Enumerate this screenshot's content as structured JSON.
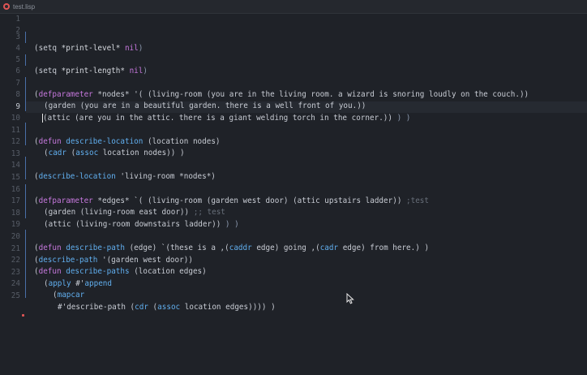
{
  "tab": {
    "title": "test.lisp"
  },
  "line_numbers": [
    "1",
    "2",
    "3",
    "4",
    "5",
    "6",
    "7",
    "8",
    "9",
    "10",
    "11",
    "12",
    "13",
    "14",
    "15",
    "16",
    "17",
    "18",
    "19",
    "20",
    "21",
    "22",
    "23",
    "24",
    "25"
  ],
  "lines": {
    "l3": [
      "(setq ",
      "*print-level*",
      " nil",
      ")"
    ],
    "l5": [
      "(setq ",
      "*print-length*",
      " nil",
      ")"
    ],
    "l7": [
      "(",
      "defparameter",
      " *nodes* '(",
      " ",
      "(living-room (you are in the living room. a wizard is snoring loudly on the couch.))"
    ],
    "l8": [
      "(garden (you are in a beautiful garden. there is a well front of you.))"
    ],
    "l9": [
      "(attic (are you in the attic. there is a giant welding torch in the corner.))",
      " ) )"
    ],
    "l11": [
      "(",
      "defun",
      " ",
      "describe-location",
      " (location nodes)"
    ],
    "l12": [
      "(",
      "cadr",
      " (",
      "assoc",
      " location nodes)) )"
    ],
    "l14": [
      "(",
      "describe-location",
      " 'living-room *nodes*)"
    ],
    "l16": [
      "(",
      "defparameter",
      " *edges* `(",
      " ",
      "(living-room (garden west door) (attic upstairs ladder))",
      " ;test"
    ],
    "l17": [
      "(garden (living-room east door))",
      " ;; test"
    ],
    "l18": [
      "(attic (living-room downstairs ladder))",
      " ) )"
    ],
    "l20": [
      "(",
      "defun",
      " ",
      "describe-path",
      " (edge) `(these is a ,(",
      "caddr",
      " edge) going ,(",
      "cadr",
      " edge) from here.) )"
    ],
    "l21": [
      "(",
      "describe-path",
      " '(garden west door))"
    ],
    "l22": [
      "(",
      "defun",
      " ",
      "describe-paths",
      " (location edges)"
    ],
    "l23": [
      "(",
      "apply",
      " #'",
      "append"
    ],
    "l24": [
      "(",
      "mapcar"
    ],
    "l25": [
      "#'describe-path (",
      "cdr",
      " (",
      "assoc",
      " location edges)))) )"
    ]
  },
  "editor": {
    "active_line": "9",
    "accent": "#4a6fa8",
    "keyword_color": "#c678dd",
    "function_color": "#61afef"
  },
  "icons": {
    "tab_icon": "lisp-file-icon",
    "pointer": "mouse-pointer-icon"
  }
}
